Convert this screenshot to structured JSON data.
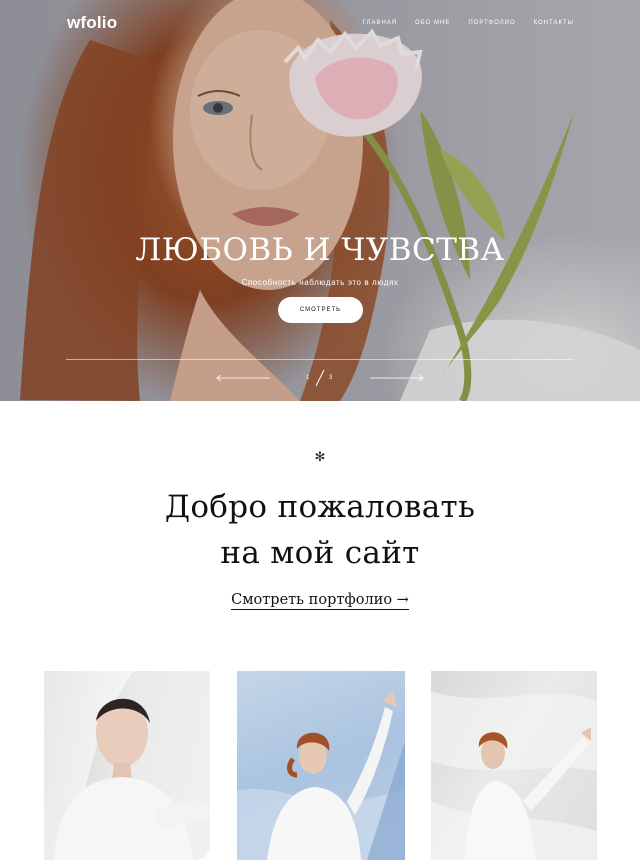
{
  "header": {
    "logo": "wfolio",
    "nav": [
      "ГЛАВНАЯ",
      "ОБО МНЕ",
      "ПОРТФОЛИО",
      "КОНТАКТЫ"
    ]
  },
  "hero": {
    "title": "ЛЮБОВЬ И ЧУВСТВА",
    "subtitle": "Способность наблюдать это в людях",
    "button": "СМОТРЕТЬ",
    "slider": {
      "current": "1",
      "total": "3"
    }
  },
  "welcome": {
    "icon": "asterisk-icon",
    "line1": "Добро пожаловать",
    "line2": "на мой сайт",
    "link": "Смотреть портфолио",
    "link_arrow": "→"
  },
  "gallery": {
    "cards": [
      {
        "name": "portrait-veil",
        "tone": "#e9e9ea"
      },
      {
        "name": "portrait-blue-fabric",
        "tone": "#aac3df"
      },
      {
        "name": "portrait-white-fabric",
        "tone": "#e3e4e5"
      }
    ]
  },
  "colors": {
    "text": "#111111",
    "hero_overlay_text": "#ffffff",
    "background": "#ffffff"
  }
}
